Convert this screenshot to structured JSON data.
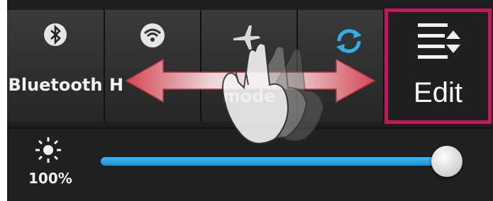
{
  "quick_settings": {
    "tiles": [
      {
        "label": "Bluetooth",
        "icon": "bluetooth-icon"
      },
      {
        "label": "H",
        "icon": "wifi-hotspot-icon"
      },
      {
        "label": "mode",
        "icon": "airplane-icon"
      },
      {
        "label": "",
        "icon": "sync-icon"
      }
    ],
    "edit": {
      "label": "Edit",
      "icon": "edit-reorder-icon"
    }
  },
  "brightness": {
    "label": "100%",
    "icon": "sun-icon",
    "level": 1.0
  },
  "gesture": {
    "icon": "swipe-hand-icon",
    "arrow": "double-arrow-icon"
  },
  "colors": {
    "highlight": "#c2185b",
    "slider": "#2aa6e6",
    "sync": "#2fb0e8",
    "arrow": "#e45a63"
  }
}
